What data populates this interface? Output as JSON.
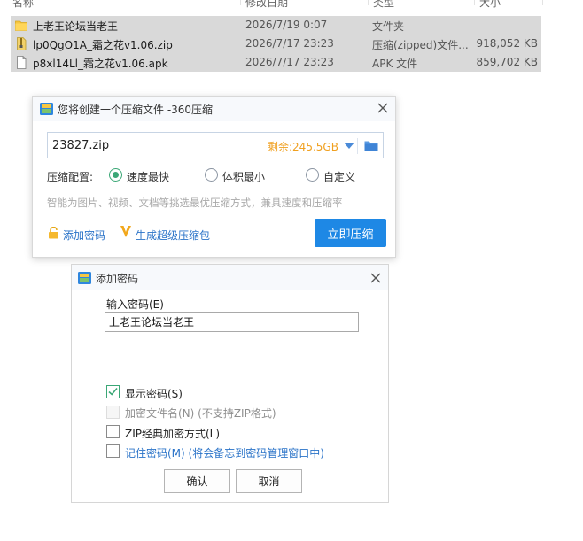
{
  "explorer": {
    "columns": {
      "name": "名称",
      "date": "修改日期",
      "type": "类型",
      "size": "大小"
    },
    "rows": [
      {
        "icon": "folder-icon",
        "name": "上老王论坛当老王",
        "date": "2026/7/19 0:07",
        "type": "文件夹",
        "size": ""
      },
      {
        "icon": "zip-file-icon",
        "name": "lp0QgO1A_霜之花v1.06.zip",
        "date": "2026/7/17 23:23",
        "type": "压缩(zipped)文件...",
        "size": "918,052 KB"
      },
      {
        "icon": "apk-file-icon",
        "name": "p8xl14Ll_霜之花v1.06.apk",
        "date": "2026/7/17 23:23",
        "type": "APK 文件",
        "size": "859,702 KB"
      }
    ]
  },
  "create_dialog": {
    "title": "您将创建一个压缩文件 -360压缩",
    "filename": "23827.zip",
    "free_space": "剩余:245.5GB",
    "config_label": "压缩配置:",
    "options": [
      {
        "label": "速度最快",
        "selected": true
      },
      {
        "label": "体积最小",
        "selected": false
      },
      {
        "label": "自定义",
        "selected": false
      }
    ],
    "hint": "智能为图片、视频、文档等挑选最优压缩方式，兼具速度和压缩率",
    "add_password": "添加密码",
    "super_pack": "生成超级压缩包",
    "compress_button": "立即压缩"
  },
  "password_dialog": {
    "title": "添加密码",
    "input_label": "输入密码(E)",
    "password_value": "上老王论坛当老王",
    "checkboxes": [
      {
        "label": "显示密码(S)",
        "checked": true,
        "disabled": false
      },
      {
        "label": "加密文件名(N) (不支持ZIP格式)",
        "checked": false,
        "disabled": true
      },
      {
        "label": "ZIP经典加密方式(L)",
        "checked": false,
        "disabled": false
      },
      {
        "label": "记住密码(M) (将会备忘到密码管理窗口中)",
        "checked": false,
        "disabled": false
      }
    ],
    "ok_label": "确认",
    "cancel_label": "取消"
  },
  "colors": {
    "accent": "#1e88e5",
    "checked": "#3ba776",
    "free_space": "#f0a020",
    "link": "#2a73c8"
  }
}
